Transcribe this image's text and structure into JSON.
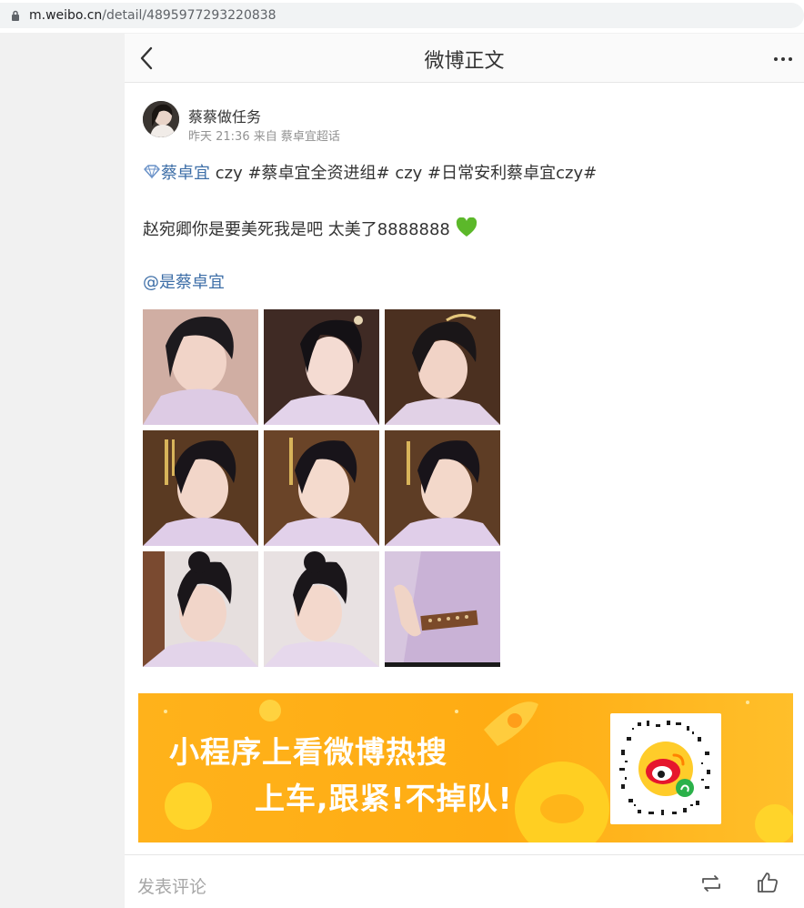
{
  "browser": {
    "url_domain": "m.weibo.cn",
    "url_path": "/detail/4895977293220838"
  },
  "navbar": {
    "title": "微博正文"
  },
  "post": {
    "author": "蔡蔡做任务",
    "meta": "昨天 21:36 来自 蔡卓宜超话",
    "topic_link": "蔡卓宜",
    "line1_rest": " czy #蔡卓宜全资进组# czy #日常安利蔡卓宜czy#",
    "line2": "赵宛卿你是要美死我是吧 太美了8888888 ",
    "mention": "@是蔡卓宜",
    "images": [
      "photo-1",
      "photo-2",
      "photo-3",
      "photo-4",
      "photo-5",
      "photo-6",
      "photo-7",
      "photo-8",
      "photo-9"
    ]
  },
  "banner": {
    "line1": "小程序上看微博热搜",
    "line2": "上车,跟紧!不掉队!"
  },
  "footer": {
    "comment_placeholder": "发表评论"
  },
  "colors": {
    "link": "#3d6ea7",
    "banner": "#ffac13",
    "heart": "#5cb82a"
  }
}
